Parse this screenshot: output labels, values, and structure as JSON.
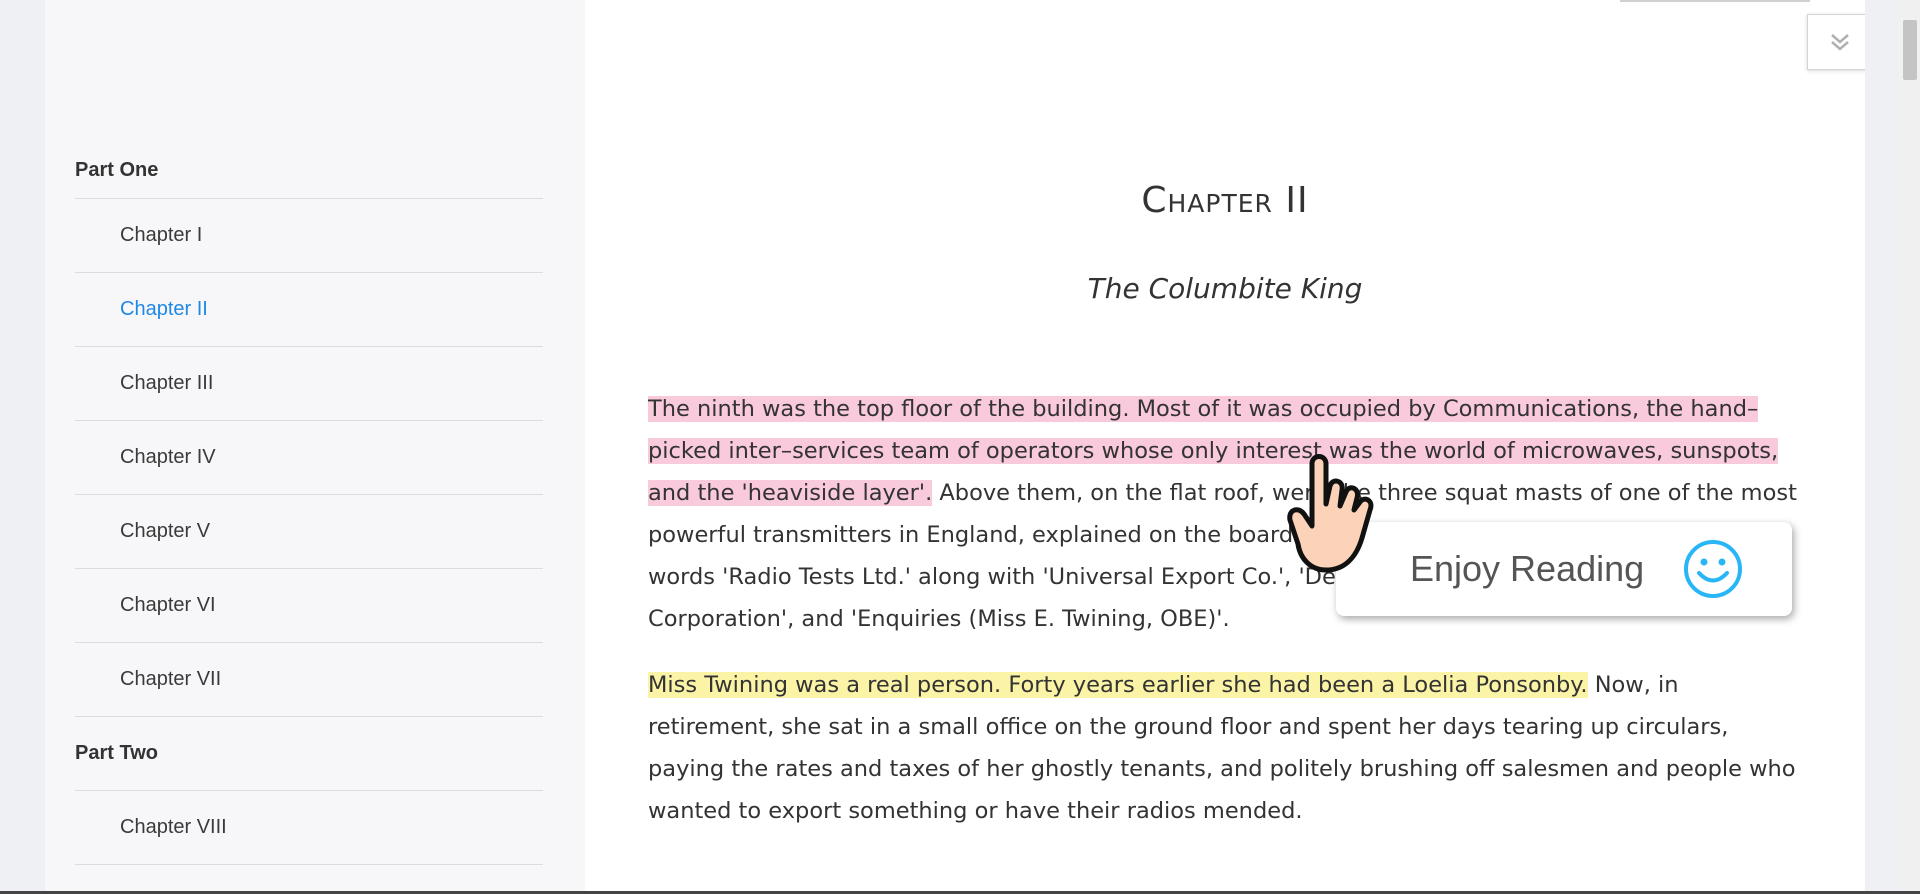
{
  "sidebar": {
    "parts": [
      {
        "label": "Part One"
      },
      {
        "label": "Part Two"
      }
    ],
    "part_one_chapters": [
      {
        "label": "Chapter I"
      },
      {
        "label": "Chapter II"
      },
      {
        "label": "Chapter III"
      },
      {
        "label": "Chapter IV"
      },
      {
        "label": "Chapter V"
      },
      {
        "label": "Chapter VI"
      },
      {
        "label": "Chapter VII"
      }
    ],
    "part_two_chapters": [
      {
        "label": "Chapter VIII"
      }
    ],
    "active_chapter": "Chapter II"
  },
  "chapter": {
    "title": "Chapter II",
    "subtitle": "The Columbite King"
  },
  "paragraphs": {
    "p1_highlight": "The ninth was the top floor of the building. Most of it was occupied by Communications, the hand–picked inter–services team of operators whose only interest was the world of microwaves, sunspots, and the 'heaviside layer'.",
    "p1_rest": " Above them, on the flat roof, were the three squat masts of one of the most powerful transmitters in England, explained on the board in the entrance hall of the building by the words 'Radio Tests Ltd.' along with 'Universal Export Co.', 'Delaney Bros. (1940) Ltd.', 'The Omnium Corporation', and 'Enquiries (Miss E. Twining, OBE)'.",
    "p2_highlight": "Miss Twining was a real person. Forty years earlier she had been a Loelia Ponsonby.",
    "p2_rest": " Now, in retirement, she sat in a small office on the ground floor and spent her days tearing up circulars, paying the rates and taxes of her ghostly tenants, and politely brushing off salesmen and people who wanted to export something or have their radios mended."
  },
  "popup": {
    "text": "Enjoy Reading",
    "icon": "smiley-icon"
  },
  "colors": {
    "accent": "#1e88e5",
    "highlight_pink": "#f9c9dc",
    "highlight_yellow": "#fbf3a6"
  }
}
